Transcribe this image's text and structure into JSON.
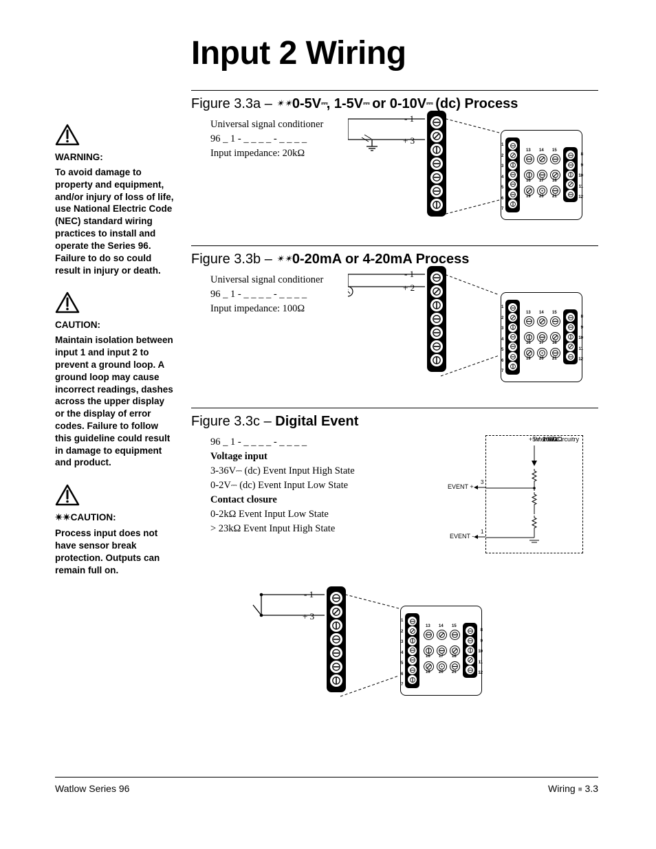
{
  "title": "Input 2 Wiring",
  "figA": {
    "num": "Figure 3.3a – ",
    "ast": "✴✴",
    "title_p1": "0-5V",
    "title_p2": ", 1-5V",
    "title_p3": " or 0-10V",
    "title_p4": " (dc) Process",
    "line1": "Universal signal conditioner",
    "line2": "96 _ 1 - _ _ _ _ - _ _ _ _",
    "line3": "Input impedance: 20kΩ",
    "t_neg": "- 1",
    "t_pos": "+ 3"
  },
  "figB": {
    "num": "Figure 3.3b – ",
    "ast": "✴✴",
    "title": "0-20mA or 4-20mA Process",
    "line1": "Universal signal conditioner",
    "line2": "96 _ 1 - _ _ _ _ - _ _ _ _",
    "line3": "Input impedance: 100Ω",
    "t_neg": "- 1",
    "t_pos": "+ 2"
  },
  "figC": {
    "num": "Figure 3.3c – ",
    "title": "Digital Event",
    "line1": "96 _ 1 - _ _ _ _ - _ _ _ _",
    "h1": "Voltage input",
    "v1a": "3-36V",
    "v1b": " (dc) Event Input High State",
    "v2a": "0-2V",
    "v2b": " (dc) Event Input Low State",
    "h2": "Contact closure",
    "c1": "0-2kΩ Event Input Low State",
    "c2": "> 23kΩ Event Input High State",
    "ic_5v": "+5V",
    "ic_r1": "2.67kΩ",
    "ic_r2": "20kΩ",
    "ic_r3": "100Ω",
    "ic_ep": "EVENT +",
    "ic_em": "EVENT -",
    "ic_n3": "3",
    "ic_n1": "1",
    "ic_txt": "Internal Circuitry",
    "t_neg": "- 1",
    "t_pos": "+ 3"
  },
  "warn": {
    "h": "WARNING:",
    "t": "To avoid damage to property and equipment, and/or injury of loss of life, use National Electric Code (NEC) standard wiring practices to install and operate the Series 96. Failure to do so could result in injury or death."
  },
  "caut1": {
    "h": "CAUTION:",
    "t": "Maintain isolation between input 1 and input 2 to prevent a ground loop. A ground loop may cause incorrect readings, dashes across the upper display or the display of error codes. Failure to follow this guideline could result in damage to equipment and product."
  },
  "caut2": {
    "h": "✴✴CAUTION:",
    "t": "Process input does not have sensor break protection. Outputs can remain full on."
  },
  "footer": {
    "left": "Watlow Series 96",
    "right_a": "Wiring",
    "right_b": "3.3"
  },
  "device_nums_top": [
    "13",
    "14",
    "15",
    "16",
    "17",
    "18",
    "19",
    "20",
    "21"
  ],
  "device_nums_left": [
    "1",
    "2",
    "3",
    "4",
    "5",
    "6",
    "7"
  ],
  "device_nums_right": [
    "8",
    "9",
    "10",
    "11",
    "12"
  ]
}
